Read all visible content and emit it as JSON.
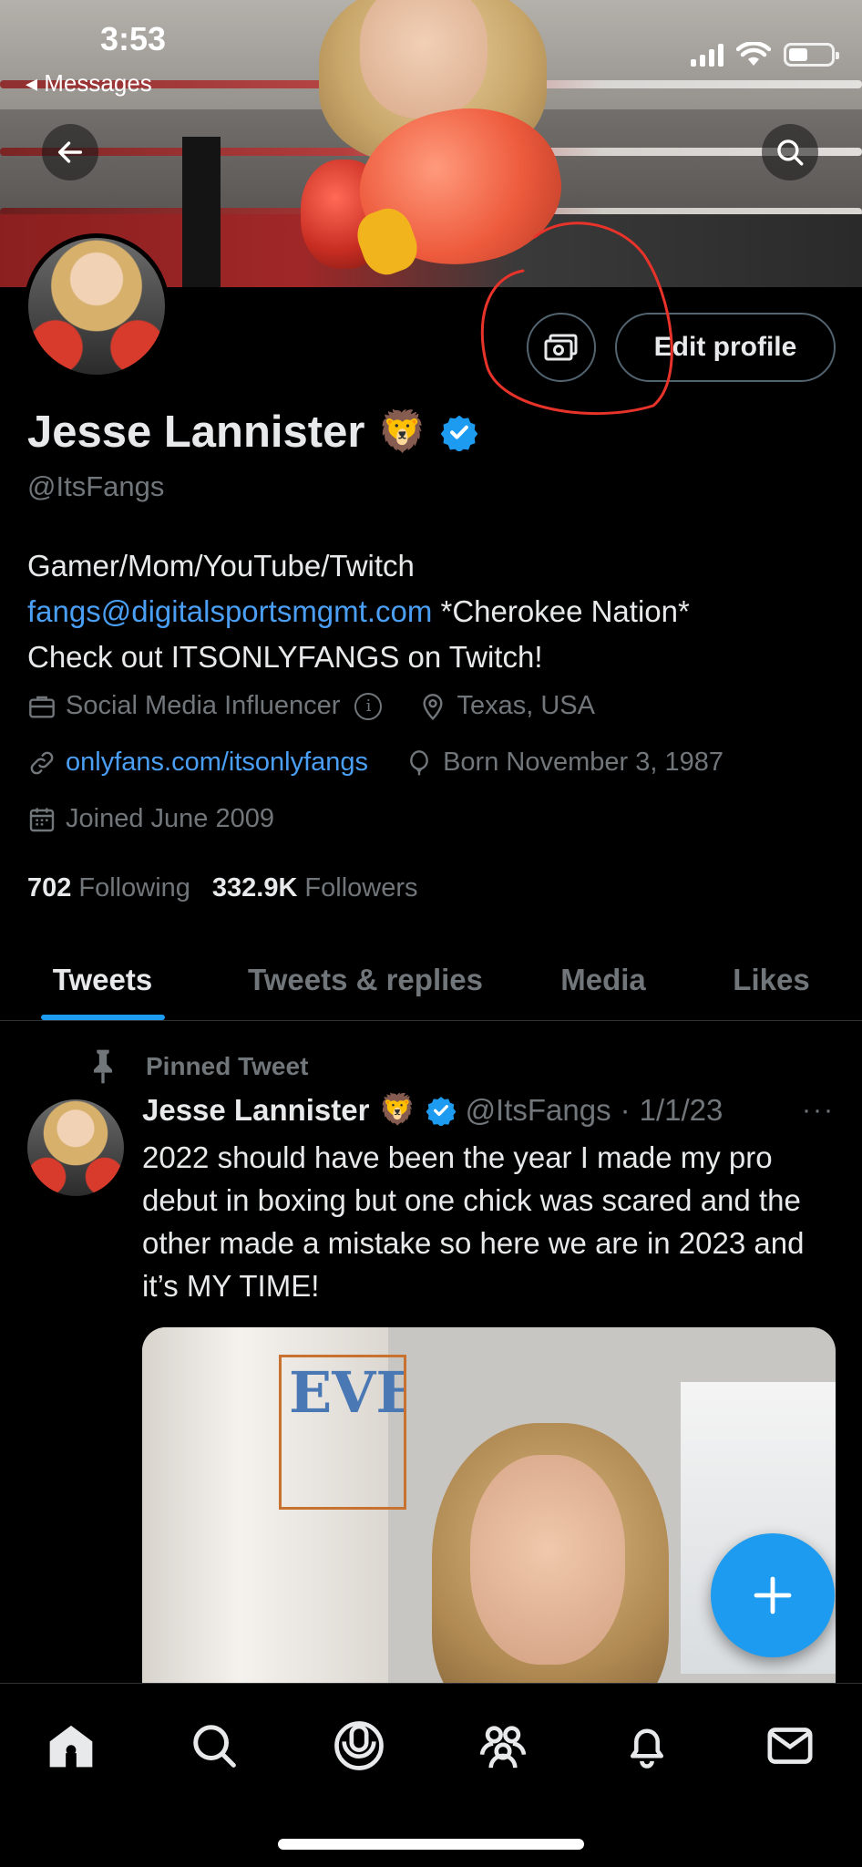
{
  "status_bar": {
    "time": "3:53",
    "back_app": "◂ Messages"
  },
  "profile": {
    "display_name": "Jesse Lannister",
    "name_emoji": "🦁",
    "handle": "@ItsFangs",
    "edit_button_label": "Edit profile",
    "bio": {
      "line1": "Gamer/Mom/YouTube/Twitch",
      "email": "fangs@digitalsportsmgmt.com",
      "line2_rest": " *Cherokee Nation*",
      "line3": "Check out ITSONLYFANGS on Twitch!"
    },
    "category": "Social Media Influencer",
    "location": "Texas, USA",
    "website": "onlyfans.com/itsonlyfangs",
    "birthday": "Born November 3, 1987",
    "joined": "Joined June 2009",
    "following_count": "702",
    "following_label": "Following",
    "followers_count": "332.9K",
    "followers_label": "Followers"
  },
  "tabs": [
    {
      "label": "Tweets",
      "active": true
    },
    {
      "label": "Tweets & replies",
      "active": false
    },
    {
      "label": "Media",
      "active": false
    },
    {
      "label": "Likes",
      "active": false
    }
  ],
  "pinned_tweet": {
    "pinned_label": "Pinned Tweet",
    "author_name": "Jesse Lannister",
    "author_emoji": "🦁",
    "author_handle": "@ItsFangs",
    "separator": "·",
    "date": "1/1/23",
    "more": "···",
    "text": "2022 should have been the year I made my pro debut in boxing but one chick was scared and the other made a mistake so here we are in 2023 and it’s MY TIME!",
    "media_bag_text": "EVERL"
  },
  "colors": {
    "background": "#000000",
    "primary_text": "#e7e9ea",
    "secondary_text": "#71767b",
    "link": "#4a9ff5",
    "accent": "#1d9bf0",
    "verified": "#1d9bf0",
    "annotation": "#e8332a"
  },
  "icons": {
    "back": "arrow-left-icon",
    "search": "search-icon",
    "money": "money-icon",
    "verified": "verified-badge-icon",
    "category": "briefcase-icon",
    "info": "info-icon",
    "location": "location-pin-icon",
    "link": "link-icon",
    "birthday": "balloon-icon",
    "calendar": "calendar-icon",
    "pin": "pin-icon",
    "compose": "plus-icon",
    "nav": [
      "home-icon",
      "search-icon",
      "spaces-icon",
      "communities-icon",
      "notifications-icon",
      "messages-icon"
    ]
  }
}
